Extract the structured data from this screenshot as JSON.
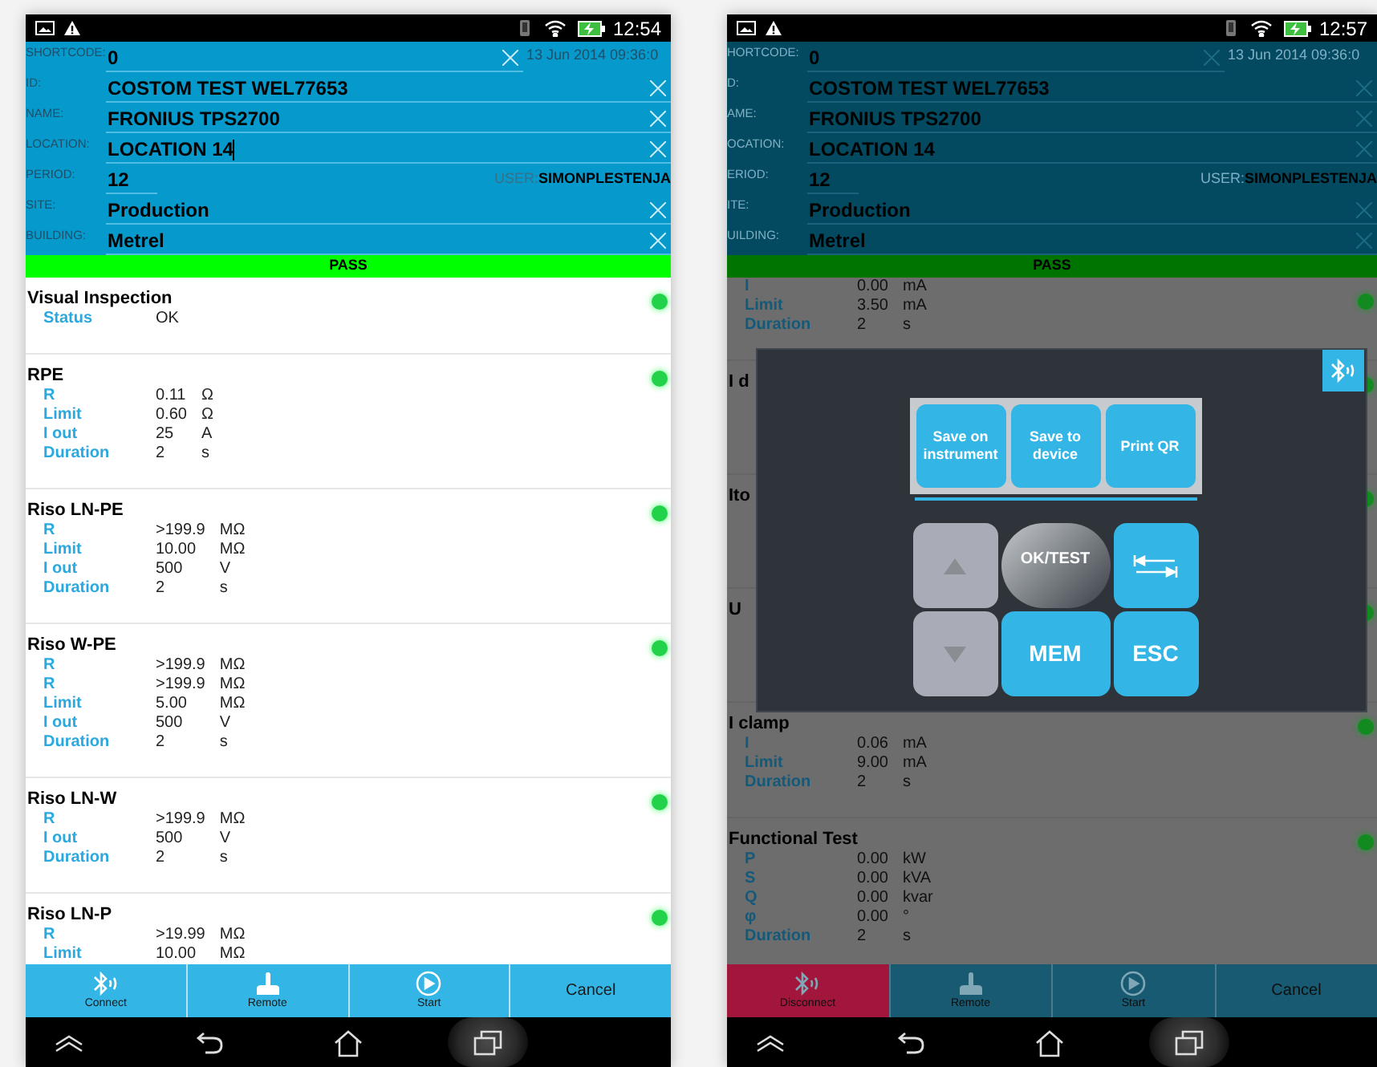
{
  "screens": [
    {
      "dimmed": false,
      "status_bar": {
        "time": "12:54"
      },
      "fields": [
        {
          "kind": "shortcode",
          "label": "SHORTCODE:",
          "value": "0",
          "date": "13 Jun 2014 09:36:0",
          "focused": false
        },
        {
          "kind": "text",
          "label": "ID:",
          "value": "COSTOM TEST WEL77653",
          "focused": false
        },
        {
          "kind": "text",
          "label": "NAME:",
          "value": "FRONIUS TPS2700",
          "focused": false
        },
        {
          "kind": "text",
          "label": "LOCATION:",
          "value": "LOCATION 14",
          "focused": true
        },
        {
          "kind": "period",
          "label": "PERIOD:",
          "value": "12",
          "user_label": "USER:",
          "user": "SIMONPLESTENJA",
          "focused": false
        },
        {
          "kind": "text",
          "label": "SITE:",
          "value": "Production",
          "focused": false
        },
        {
          "kind": "text",
          "label": "BUILDING:",
          "value": "Metrel",
          "focused": false
        }
      ],
      "result": "PASS",
      "tests": [
        {
          "title": "Visual Inspection",
          "rows": [
            {
              "label": "Status",
              "value": "OK"
            }
          ]
        },
        {
          "title": "RPE",
          "rows": [
            {
              "label": "R",
              "value": "0.11",
              "unit": "Ω"
            },
            {
              "label": "Limit",
              "value": "0.60",
              "unit": "Ω"
            },
            {
              "label": "I out",
              "value": "25",
              "unit": "A"
            },
            {
              "label": "Duration",
              "value": "2",
              "unit": "s"
            }
          ]
        },
        {
          "title": "Riso LN-PE",
          "rows": [
            {
              "label": "R",
              "value": ">199.9",
              "unit": "MΩ"
            },
            {
              "label": "Limit",
              "value": "10.00",
              "unit": "MΩ"
            },
            {
              "label": "I out",
              "value": "500",
              "unit": "V"
            },
            {
              "label": "Duration",
              "value": "2",
              "unit": "s"
            }
          ]
        },
        {
          "title": "Riso W-PE",
          "rows": [
            {
              "label": "R",
              "value": ">199.9",
              "unit": "MΩ"
            },
            {
              "label": "R",
              "value": ">199.9",
              "unit": "MΩ"
            },
            {
              "label": "Limit",
              "value": "5.00",
              "unit": "MΩ"
            },
            {
              "label": "I out",
              "value": "500",
              "unit": "V"
            },
            {
              "label": "Duration",
              "value": "2",
              "unit": "s"
            }
          ]
        },
        {
          "title": "Riso LN-W",
          "rows": [
            {
              "label": "R",
              "value": ">199.9",
              "unit": "MΩ"
            },
            {
              "label": "I out",
              "value": "500",
              "unit": "V"
            },
            {
              "label": "Duration",
              "value": "2",
              "unit": "s"
            }
          ]
        },
        {
          "title": "Riso LN-P",
          "rows": [
            {
              "label": "R",
              "value": ">19.99",
              "unit": "MΩ"
            },
            {
              "label": "Limit",
              "value": "10.00",
              "unit": "MΩ"
            }
          ]
        }
      ],
      "buttons": [
        {
          "kind": "bluetooth",
          "label": "Connect",
          "highlighted": false
        },
        {
          "kind": "joystick",
          "label": "Remote",
          "highlighted": false
        },
        {
          "kind": "play",
          "label": "Start",
          "highlighted": false
        },
        {
          "kind": "text",
          "label": "Cancel",
          "highlighted": false
        }
      ]
    },
    {
      "dimmed": true,
      "status_bar": {
        "time": "12:57"
      },
      "fields": [
        {
          "kind": "shortcode",
          "label": "HORTCODE:",
          "value": "0",
          "date": "13 Jun 2014 09:36:0",
          "focused": false
        },
        {
          "kind": "text",
          "label": "D:",
          "value": "COSTOM TEST WEL77653",
          "focused": false
        },
        {
          "kind": "text",
          "label": "AME:",
          "value": "FRONIUS TPS2700",
          "focused": false
        },
        {
          "kind": "text",
          "label": "OCATION:",
          "value": "LOCATION 14",
          "focused": false
        },
        {
          "kind": "period",
          "label": "ERIOD:",
          "value": "12",
          "user_label": "USER:",
          "user": "SIMONPLESTENJA",
          "focused": false
        },
        {
          "kind": "text",
          "label": "ITE:",
          "value": "Production",
          "focused": false
        },
        {
          "kind": "text",
          "label": "UILDING:",
          "value": "Metrel",
          "focused": false
        }
      ],
      "result": "PASS",
      "tests": [
        {
          "rows": [
            {
              "label": "I",
              "value": "0.00",
              "unit": "mA"
            },
            {
              "label": "Limit",
              "value": "3.50",
              "unit": "mA"
            },
            {
              "label": "Duration",
              "value": "2",
              "unit": "s"
            }
          ]
        },
        {
          "title": "I d"
        },
        {
          "title": "Ito"
        },
        {
          "title": "U"
        },
        {
          "title": "I clamp",
          "rows": [
            {
              "label": "I",
              "value": "0.06",
              "unit": "mA"
            },
            {
              "label": "Limit",
              "value": "9.00",
              "unit": "mA"
            },
            {
              "label": "Duration",
              "value": "2",
              "unit": "s"
            }
          ]
        },
        {
          "title": "Functional Test",
          "rows": [
            {
              "label": "P",
              "value": "0.00",
              "unit": "kW"
            },
            {
              "label": "S",
              "value": "0.00",
              "unit": "kVA"
            },
            {
              "label": "Q",
              "value": "0.00",
              "unit": "kvar"
            },
            {
              "label": "φ",
              "value": "0.00",
              "unit": "°"
            },
            {
              "label": "Duration",
              "value": "2",
              "unit": "s"
            }
          ]
        }
      ],
      "buttons": [
        {
          "kind": "bluetooth",
          "label": "Disconnect",
          "highlighted": true
        },
        {
          "kind": "joystick",
          "label": "Remote",
          "highlighted": false
        },
        {
          "kind": "play",
          "label": "Start",
          "highlighted": false
        },
        {
          "kind": "text",
          "label": "Cancel",
          "highlighted": false
        }
      ],
      "dialog": {
        "actions": [
          "Save on instrument",
          "Save to device",
          "Print QR"
        ],
        "keys": [
          {
            "kind": "up"
          },
          {
            "kind": "ok",
            "label": "OK/TEST"
          },
          {
            "kind": "tab"
          },
          {
            "kind": "down"
          },
          {
            "kind": "mem",
            "label": "MEM"
          },
          {
            "kind": "esc",
            "label": "ESC"
          }
        ]
      }
    }
  ]
}
